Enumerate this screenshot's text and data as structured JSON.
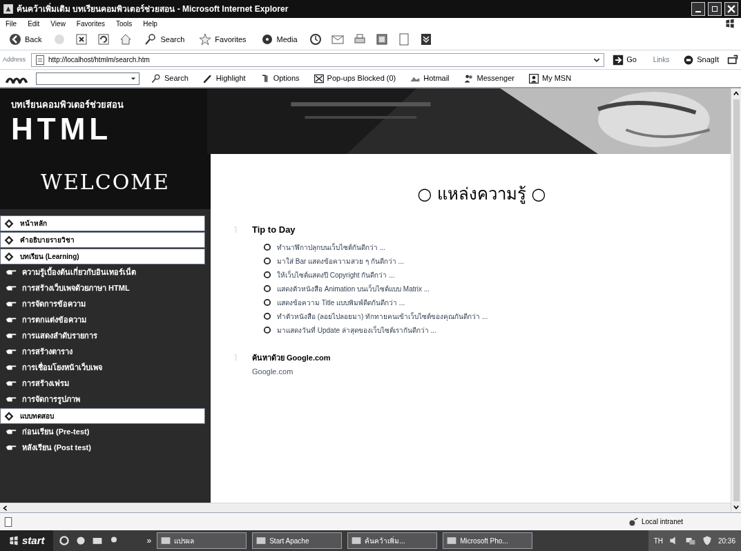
{
  "window": {
    "title": "ค้นคว้าเพิ่มเติม บทเรียนคอมพิวเตอร์ช่วยสอน - Microsoft Internet Explorer"
  },
  "menu": [
    "File",
    "Edit",
    "View",
    "Favorites",
    "Tools",
    "Help"
  ],
  "toolbar": {
    "back": "Back",
    "search": "Search",
    "favorites": "Favorites",
    "media": "Media"
  },
  "address": {
    "label": "Address",
    "value": "http://localhost/htmlm/search.htm",
    "go": "Go",
    "links": "Links",
    "snagit": "SnagIt"
  },
  "msn_bar": {
    "search": "Search",
    "highlight": "Highlight",
    "options": "Options",
    "popups": "Pop-ups Blocked (0)",
    "hotmail": "Hotmail",
    "messenger": "Messenger",
    "my_msn": "My MSN"
  },
  "banner": {
    "subtitle": "บทเรียนคอมพิวเตอร์ช่วยสอน",
    "logo": "HTML",
    "welcome": "WELCOME"
  },
  "sidebar": {
    "items": [
      {
        "label": "หน้าหลัก"
      },
      {
        "label": "คำอธิบายรายวิชา"
      },
      {
        "label": "บทเรียน (Learning)",
        "children": [
          {
            "label": "ความรู้เบื้องต้นเกี่ยวกับอินเทอร์เน็ต"
          },
          {
            "label": "การสร้างเว็บเพจด้วยภาษา HTML"
          },
          {
            "label": "การจัดการข้อความ"
          },
          {
            "label": "การตกแต่งข้อความ"
          },
          {
            "label": "การแสดงลำดับรายการ"
          },
          {
            "label": "การสร้างตาราง"
          },
          {
            "label": "การเชื่อมโยงหน้าเว็บเพจ"
          },
          {
            "label": "การสร้างเฟรม"
          },
          {
            "label": "การจัดการรูปภาพ"
          }
        ]
      },
      {
        "label": "แบบทดสอบ",
        "children": [
          {
            "label": "ก่อนเรียน (Pre-test)"
          },
          {
            "label": "หลังเรียน (Post test)"
          }
        ]
      }
    ]
  },
  "main": {
    "heading": "○ แหล่งความรู้ ○",
    "tips_title": "Tip to Day",
    "tips": [
      "ทำนาฬิกาปลุกบนเว็บไซต์กันดีกว่า ...",
      "มาใส่ Bar แสดงข้อความสวย ๆ กันดีกว่า ...",
      "ให้เว็บไซต์แสดงปี Copyright กันดีกว่า ...",
      "แสดงตัวหนังสือ Animation บนเว็บไซต์แบบ Matrix ...",
      "แสดงข้อความ Title แบบพิมพ์ดีดกันดีกว่า ...",
      "ทำตัวหนังสือ (ลอยไปลอยมา) ทักทายคนเข้าเว็บไซต์ของคุณกันดีกว่า ...",
      "มาแสดงวันที่ Update ล่าสุดของเว็บไซต์เรากันดีกว่า ..."
    ],
    "search_title": "ค้นหาด้วย Google.com",
    "search_link": "Google.com"
  },
  "status_bar": {
    "zone": "Local intranet"
  },
  "taskbar": {
    "start": "start",
    "more": "»",
    "tasks": [
      "แปรผล",
      "Start Apache",
      "ค้นคว้าเพิ่ม...",
      "Microsoft Pho..."
    ],
    "language": "TH",
    "clock": "20:36"
  }
}
